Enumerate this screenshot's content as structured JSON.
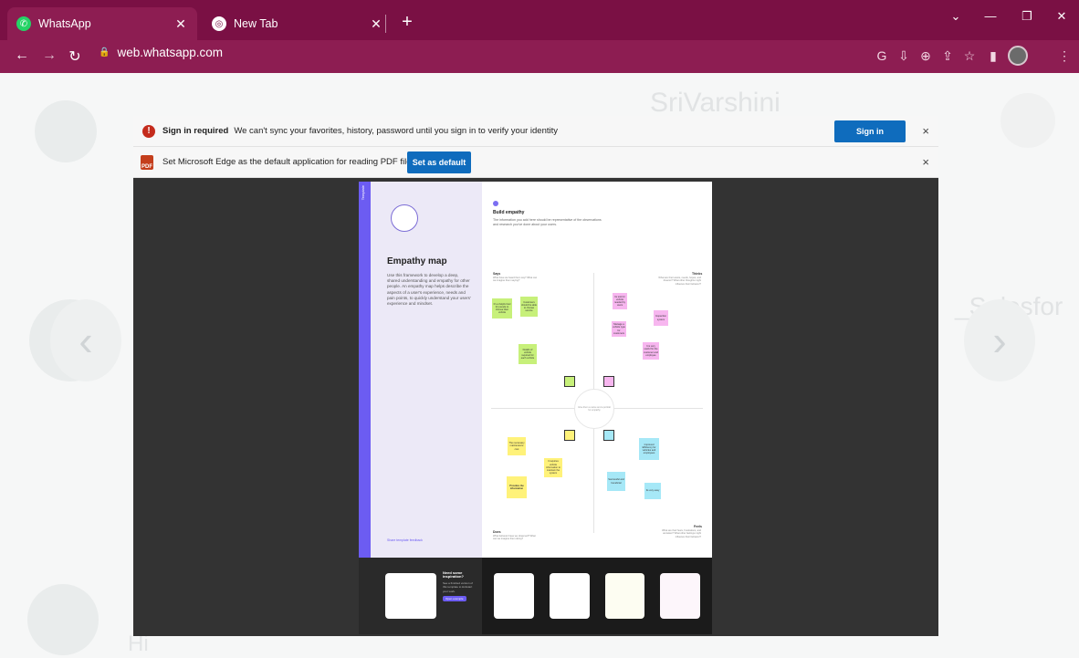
{
  "browser": {
    "tabs": [
      {
        "title": "WhatsApp",
        "active": true
      },
      {
        "title": "New Tab",
        "active": false
      }
    ],
    "url": "web.whatsapp.com",
    "accent": "#7a1044"
  },
  "background_app": {
    "contact_name": "SriVarshini",
    "side_text": "_Salesfor",
    "message": "Hi"
  },
  "infobar_signin": {
    "label": "Sign in required",
    "message": "We can't sync your favorites, history, password until you sign in to verify your identity",
    "button": "Sign in",
    "close": "×"
  },
  "infobar_default": {
    "message": "Set Microsoft Edge as the default application for reading PDF files?",
    "button": "Set as default",
    "close": "×"
  },
  "pdf": {
    "strip_label": "Template",
    "title": "Empathy map",
    "body": "Use this framework to develop a deep, shared understanding and empathy for other people. An empathy map helps describe the aspects of a user's experience, needs and pain points, to quickly understand your users' experience and mindset.",
    "footer": "Share template feedback",
    "section_title": "Build empathy",
    "section_body": "The information you add here should be representative of the observations and research you've done about your users.",
    "center": "Give them a name and a portrait for empathy",
    "quadrants": {
      "says": {
        "label": "Says",
        "sub": "What have we heard them say? What can we imagine them saying?"
      },
      "thinks": {
        "label": "Thinks",
        "sub": "What are their wants, needs, hopes, and dreams? What other thoughts might influence their behavior?"
      },
      "does": {
        "label": "Does",
        "sub": "What behavior have we observed? What can we imagine them doing?"
      },
      "feels": {
        "label": "Feels",
        "sub": "What are their fears, frustrations, and anxieties? What other feelings might influence their behavior?"
      }
    },
    "stickies": {
      "g1": "It's a helpful tool for people to choose their vehicle",
      "g2": "Customers should be able to choose service",
      "g3": "Details of vehicle required for each vehicle",
      "p1": "Its tool for vehicle needed by users",
      "p2": "Manage a vehicle type for customers",
      "p3": "Inspection system",
      "p4": "It is very useful for the customer and employee",
      "y1": "The necessary maintenance cost",
      "y2": "It requires vehicle information to maintain the system",
      "y3": "Provides the information",
      "b1": "Improved Efficiency for vehicles and employees",
      "b2": "Successful and beneficial",
      "b3": "Its very easy"
    },
    "bottom": {
      "heading": "Need some inspiration?",
      "text": "See a finished version of this template to kickstart your work.",
      "button": "Open example"
    }
  }
}
